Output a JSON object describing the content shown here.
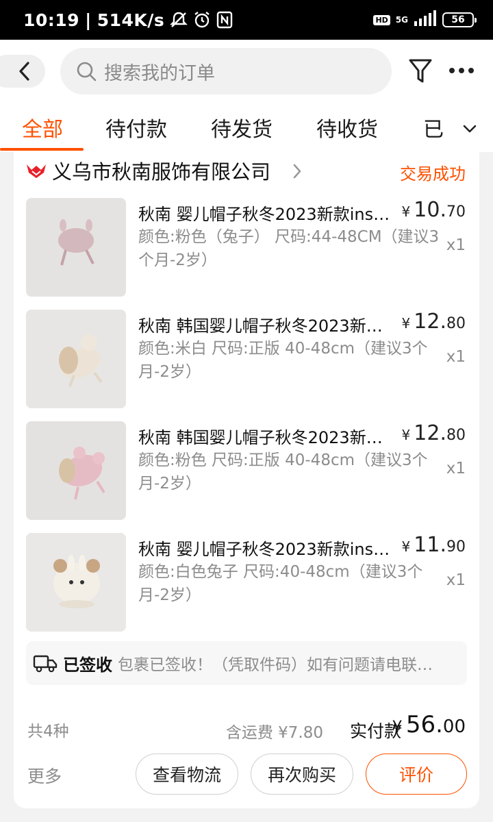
{
  "status_bar": {
    "time": "10:19",
    "speed": "514K/s",
    "network": "5G",
    "battery": "56"
  },
  "header": {
    "search_placeholder": "搜索我的订单"
  },
  "tabs": [
    {
      "label": "全部",
      "active": true
    },
    {
      "label": "待付款"
    },
    {
      "label": "待发货"
    },
    {
      "label": "待收货"
    },
    {
      "label": "已"
    }
  ],
  "order": {
    "shop_name": "义乌市秋南服饰有限公司",
    "status": "交易成功",
    "items": [
      {
        "title": "秋南 婴儿帽子秋冬2023新款ins…",
        "sku": "颜色:粉色（兔子） 尺码:44-48CM（建议3个月-2岁）",
        "price_yen": "¥",
        "price_int": "10.",
        "price_dec": "70",
        "qty": "x1"
      },
      {
        "title": "秋南 韩国婴儿帽子秋冬2023新…",
        "sku": "颜色:米白 尺码:正版 40-48cm（建议3个月-2岁）",
        "price_yen": "¥",
        "price_int": "12.",
        "price_dec": "80",
        "qty": "x1"
      },
      {
        "title": "秋南 韩国婴儿帽子秋冬2023新…",
        "sku": "颜色:粉色 尺码:正版 40-48cm（建议3个月-2岁）",
        "price_yen": "¥",
        "price_int": "12.",
        "price_dec": "80",
        "qty": "x1"
      },
      {
        "title": "秋南 婴儿帽子秋冬2023新款ins…",
        "sku": "颜色:白色兔子 尺码:40-48cm（建议3个月-2岁）",
        "price_yen": "¥",
        "price_int": "11.",
        "price_dec": "90",
        "qty": "x1"
      }
    ],
    "logistics": {
      "title": "已签收",
      "text": "包裹已签收！（凭取件码）如有问题请电联…"
    },
    "summary": {
      "count": "共4种",
      "shipping": "含运费 ¥7.80",
      "paid_label": "实付款",
      "paid_yen": "¥",
      "paid_int": "56.",
      "paid_dec": "00"
    },
    "actions": {
      "more": "更多",
      "logistics_btn": "查看物流",
      "rebuy_btn": "再次购买",
      "review_btn": "评价"
    }
  },
  "colors": {
    "accent": "#ff5000",
    "muted_text": "#8c8c8c",
    "page_bg": "#f2f2f2"
  },
  "icons": [
    "back-arrow-icon",
    "search-icon",
    "filter-icon",
    "more-dots-icon",
    "chevron-down-icon",
    "shop-logo-icon",
    "chevron-right-icon",
    "truck-icon",
    "mute-icon",
    "alarm-icon",
    "nfc-icon",
    "signal-icon",
    "battery-icon"
  ]
}
